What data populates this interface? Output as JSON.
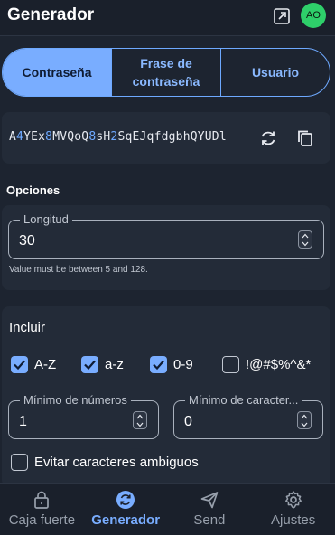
{
  "header": {
    "title": "Generador",
    "avatar_initials": "AO"
  },
  "type_options": [
    {
      "label": "Contraseña",
      "active": true
    },
    {
      "label": "Frase de contraseña",
      "active": false
    },
    {
      "label": "Usuario",
      "active": false
    }
  ],
  "password": {
    "segments": [
      {
        "text": "A",
        "num": false
      },
      {
        "text": "4",
        "num": true
      },
      {
        "text": "YEx",
        "num": false
      },
      {
        "text": "8",
        "num": true
      },
      {
        "text": "MVQoQ",
        "num": false
      },
      {
        "text": "8",
        "num": true
      },
      {
        "text": "sH",
        "num": false
      },
      {
        "text": "2",
        "num": true
      },
      {
        "text": "SqEJqfdgbhQYUDl",
        "num": false
      }
    ]
  },
  "options": {
    "title": "Opciones",
    "length_label": "Longitud",
    "length_value": "30",
    "length_hint": "Value must be between 5 and 128."
  },
  "include": {
    "title": "Incluir",
    "checks": [
      {
        "label": "A-Z",
        "checked": true
      },
      {
        "label": "a-z",
        "checked": true
      },
      {
        "label": "0-9",
        "checked": true
      },
      {
        "label": "!@#$%^&*",
        "checked": false
      }
    ],
    "min_numbers_label": "Mínimo de números",
    "min_numbers_value": "1",
    "min_special_label": "Mínimo de caracter...",
    "min_special_value": "0",
    "avoid_ambiguous_label": "Evitar caracteres ambiguos",
    "avoid_ambiguous_checked": false
  },
  "nav": [
    {
      "label": "Caja fuerte",
      "icon": "lock-icon",
      "active": false
    },
    {
      "label": "Generador",
      "icon": "generate-icon",
      "active": true
    },
    {
      "label": "Send",
      "icon": "send-icon",
      "active": false
    },
    {
      "label": "Ajustes",
      "icon": "gear-icon",
      "active": false
    }
  ],
  "colors": {
    "accent": "#79adff",
    "avatar": "#2ecf6a",
    "background": "#1d2430"
  }
}
